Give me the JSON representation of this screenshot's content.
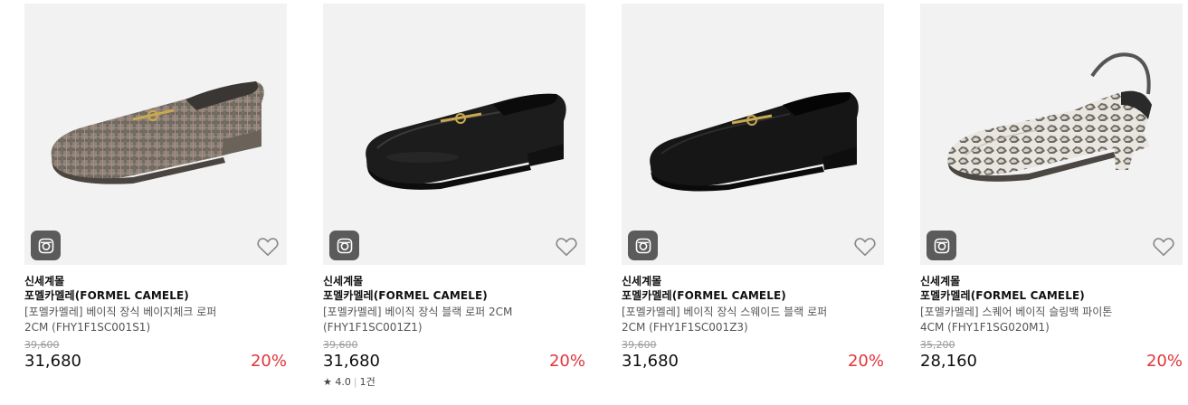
{
  "products": [
    {
      "store": "신세계몰",
      "brand": "포멜카멜레(FORMEL CAMELE)",
      "name_line1": "[포멜카멜레] 베이직 장식 베이지체크 로퍼",
      "name_line2": "2CM (FHY1F1SC001S1)",
      "original_price": "39,600",
      "price": "31,680",
      "discount": "20%",
      "image_icon": "beige-check-loafer"
    },
    {
      "store": "신세계몰",
      "brand": "포멜카멜레(FORMEL CAMELE)",
      "name_line1": "[포멜카멜레] 베이직 장식 블랙 로퍼 2CM",
      "name_line2": "(FHY1F1SC001Z1)",
      "original_price": "39,600",
      "price": "31,680",
      "discount": "20%",
      "rating": "4.0",
      "review_count": "1건",
      "image_icon": "black-leather-loafer"
    },
    {
      "store": "신세계몰",
      "brand": "포멜카멜레(FORMEL CAMELE)",
      "name_line1": "[포멜카멜레] 베이직 장식 스웨이드 블랙 로퍼",
      "name_line2": "2CM (FHY1F1SC001Z3)",
      "original_price": "39,600",
      "price": "31,680",
      "discount": "20%",
      "image_icon": "black-suede-loafer"
    },
    {
      "store": "신세계몰",
      "brand": "포멜카멜레(FORMEL CAMELE)",
      "name_line1": "[포멜카멜레] 스퀘어 베이직 슬링백 파이톤",
      "name_line2": "4CM (FHY1F1SG020M1)",
      "original_price": "35,200",
      "price": "28,160",
      "discount": "20%",
      "image_icon": "python-slingback"
    }
  ],
  "icons": {
    "instagram": "instagram-icon",
    "wishlist": "heart-outline-icon",
    "rating": "star-icon"
  },
  "colors": {
    "discount": "#e0353b",
    "thumb_bg": "#f2f2f2",
    "insta_btn": "#5b5b5b"
  }
}
